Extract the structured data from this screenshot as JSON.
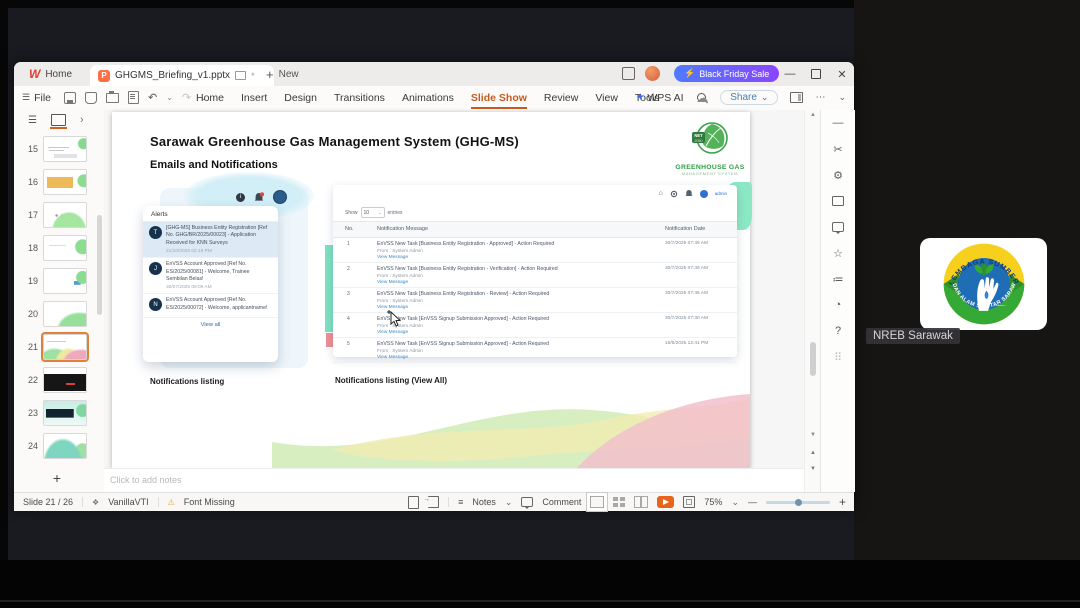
{
  "meeting": {
    "participant_name": "NREB Sarawak",
    "logo_arc_top": "LEMBAGA SUMBER ASLI",
    "logo_arc_bottom": "DAN ALAM SEKITAR SARAWAK"
  },
  "window": {
    "home_tab": "Home",
    "doc_tab": "GHGMS_Briefing_v1.pptx",
    "new_tab": "New",
    "promo_pill": "Black Friday Sale",
    "file_menu": "File",
    "menus": [
      {
        "label": "Home"
      },
      {
        "label": "Insert"
      },
      {
        "label": "Design"
      },
      {
        "label": "Transitions"
      },
      {
        "label": "Animations"
      },
      {
        "label": "Slide Show",
        "active": true
      },
      {
        "label": "Review"
      },
      {
        "label": "View"
      },
      {
        "label": "Tools"
      }
    ],
    "wps_ai": "WPS AI",
    "share_button": "Share",
    "status": {
      "slide_indicator": "Slide 21 / 26",
      "theme_name": "VanillaVTI",
      "font_missing": "Font Missing",
      "notes_label": "Notes",
      "comment_label": "Comment",
      "zoom_level": "75%"
    },
    "notes_placeholder": "Click to add notes",
    "thumbnails": [
      {
        "num": "15",
        "style": "rows"
      },
      {
        "num": "16",
        "style": "orangebox"
      },
      {
        "num": "17",
        "style": "dots"
      },
      {
        "num": "18",
        "style": "green"
      },
      {
        "num": "19",
        "style": "greenblue"
      },
      {
        "num": "20",
        "style": "green2"
      },
      {
        "num": "21",
        "style": "wave",
        "selected": true
      },
      {
        "num": "22",
        "style": "dark"
      },
      {
        "num": "23",
        "style": "tealdark"
      },
      {
        "num": "24",
        "style": "tealwave"
      }
    ]
  },
  "slide": {
    "title": "Sarawak Greenhouse Gas Management System (GHG-MS)",
    "subtitle": "Emails and Notifications",
    "logo": {
      "line1": "GREENHOUSE GAS",
      "line2": "MANAGEMENT SYSTEM",
      "badge": "NET 2050"
    },
    "caption_left": "Notifications listing",
    "caption_right": "Notifications listing (View All)",
    "alerts": {
      "header": "Alerts",
      "items": [
        {
          "initial": "T",
          "text": "[GHG-MS] Business Entity Registration [Ref No. GHG/BR/2025/00023] - Application Received for KNN Surveys",
          "date": "21/10/2025 02:19 PM",
          "highlight": true
        },
        {
          "initial": "J",
          "text": "EnVSS Account Approved [Ref No. ES/2025/00081] - Welcome, Trainee Sembilan Belas!",
          "date": "30/07/2025 08:09 AM"
        },
        {
          "initial": "N",
          "text": "EnVSS Account Approved [Ref No. ES/2025/00072] - Welcome, applicantname!",
          "date": ""
        }
      ],
      "view_all": "View all"
    },
    "webapp": {
      "user": "admin",
      "show_label": "Show",
      "page_size": "10",
      "entries_label": "entries",
      "col_no": "No.",
      "col_message": "Notification Message",
      "col_date": "Notification Date",
      "rows": [
        {
          "no": "1",
          "message": "EnVSS New Task [Business Entity Registration - Approved] - Action Required",
          "from": "From : System Admin",
          "link": "View Message",
          "date": "30/7/2025 07:49 AM"
        },
        {
          "no": "2",
          "message": "EnVSS New Task [Business Entity Registration - Verification] - Action Required",
          "from": "From : System Admin",
          "link": "View Message",
          "date": "30/7/2025 07:49 AM"
        },
        {
          "no": "3",
          "message": "EnVSS New Task [Business Entity Registration - Review] - Action Required",
          "from": "From : System Admin",
          "link": "View Message",
          "date": "30/7/2025 07:46 AM"
        },
        {
          "no": "4",
          "message": "EnVSS New Task [EnVSS Signup Submission Approved] - Action Required",
          "from": "From : System Admin",
          "link": "View Message",
          "date": "30/7/2025 07:30 AM"
        },
        {
          "no": "5",
          "message": "EnVSS New Task [EnVSS Signup Submission Approved] - Action Required",
          "from": "From : System Admin",
          "link": "View Message",
          "date": "16/6/2025 12:41 PM"
        }
      ]
    },
    "colors": {
      "accent_orange": "#c75a1e",
      "teal_bar": "#7ee0c0",
      "pink_square": "#ee8f96",
      "promo_from": "#4f7bff",
      "promo_to": "#8b45ff"
    }
  }
}
